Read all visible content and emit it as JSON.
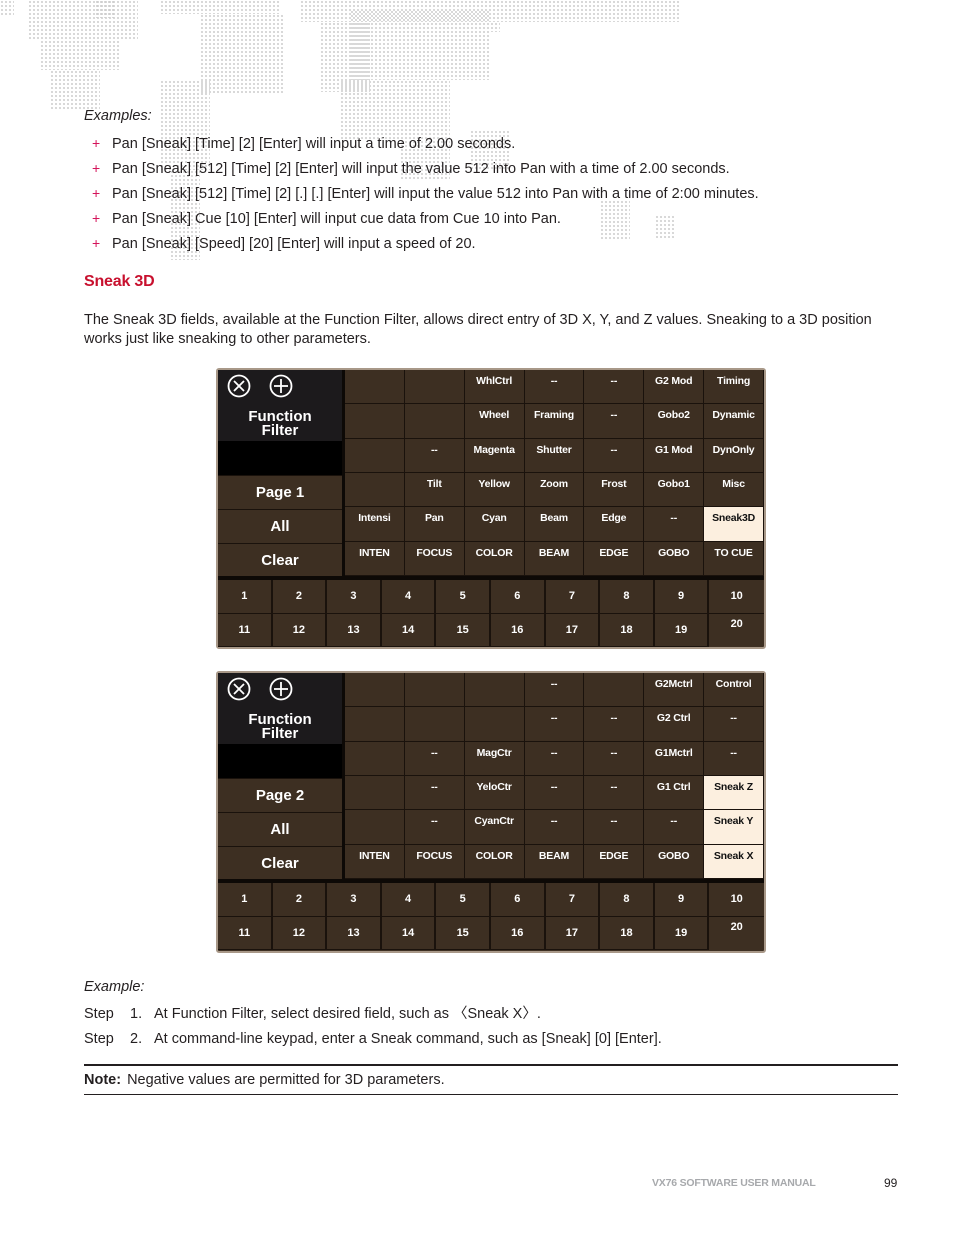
{
  "examples": {
    "label": "Examples:",
    "bullet_symbol": "+",
    "items": [
      "Pan [Sneak] [Time] [2] [Enter] will input a time of 2.00 seconds.",
      "Pan [Sneak] [512] [Time] [2] [Enter] will input the value 512 into Pan with a time of 2.00 seconds.",
      "Pan [Sneak] [512] [Time] [2] [.] [.] [Enter] will input the value 512 into Pan with a time of 2:00 minutes.",
      "Pan [Sneak] Cue [10] [Enter] will input cue data from Cue 10 into Pan.",
      "Pan [Sneak] [Speed] [20] [Enter] will input a speed of 20."
    ]
  },
  "section": {
    "title": "Sneak 3D",
    "intro": "The Sneak 3D fields, available at the Function Filter, allows direct entry of 3D X, Y, and Z values. Sneaking to a 3D position works just like sneaking to other parameters."
  },
  "panels": [
    {
      "title_line1": "Function",
      "title_line2": "Filter",
      "page_label": "Page 1",
      "all_label": "All",
      "clear_label": "Clear",
      "icons": [
        "close-circle-icon",
        "add-circle-icon"
      ],
      "grid": [
        [
          "",
          "",
          "WhlCtrl",
          "--",
          "--",
          "G2 Mod",
          "Timing"
        ],
        [
          "",
          "",
          "Wheel",
          "Framing",
          "--",
          "Gobo2",
          "Dynamic"
        ],
        [
          "",
          "--",
          "Magenta",
          "Shutter",
          "--",
          "G1 Mod",
          "DynOnly"
        ],
        [
          "",
          "Tilt",
          "Yellow",
          "Zoom",
          "Frost",
          "Gobo1",
          "Misc"
        ],
        [
          "Intensi",
          "Pan",
          "Cyan",
          "Beam",
          "Edge",
          "--",
          "Sneak3D"
        ],
        [
          "INTEN",
          "FOCUS",
          "COLOR",
          "BEAM",
          "EDGE",
          "GOBO",
          "TO CUE"
        ]
      ],
      "highlighted": [
        "4-6"
      ],
      "numbers_row1": [
        "1",
        "2",
        "3",
        "4",
        "5",
        "6",
        "7",
        "8",
        "9",
        "10"
      ],
      "numbers_row2": [
        "11",
        "12",
        "13",
        "14",
        "15",
        "16",
        "17",
        "18",
        "19",
        "20"
      ]
    },
    {
      "title_line1": "Function",
      "title_line2": "Filter",
      "page_label": "Page 2",
      "all_label": "All",
      "clear_label": "Clear",
      "icons": [
        "close-circle-icon",
        "add-circle-icon"
      ],
      "grid": [
        [
          "",
          "",
          "",
          "--",
          "",
          "G2Mctrl",
          "Control"
        ],
        [
          "",
          "",
          "",
          "--",
          "--",
          "G2 Ctrl",
          "--"
        ],
        [
          "",
          "--",
          "MagCtr",
          "--",
          "--",
          "G1Mctrl",
          "--"
        ],
        [
          "",
          "--",
          "YeloCtr",
          "--",
          "--",
          "G1 Ctrl",
          "Sneak Z"
        ],
        [
          "",
          "--",
          "CyanCtr",
          "--",
          "--",
          "--",
          "Sneak Y"
        ],
        [
          "INTEN",
          "FOCUS",
          "COLOR",
          "BEAM",
          "EDGE",
          "GOBO",
          "Sneak X"
        ]
      ],
      "highlighted": [
        "3-6",
        "4-6",
        "5-6"
      ],
      "numbers_row1": [
        "1",
        "2",
        "3",
        "4",
        "5",
        "6",
        "7",
        "8",
        "9",
        "10"
      ],
      "numbers_row2": [
        "11",
        "12",
        "13",
        "14",
        "15",
        "16",
        "17",
        "18",
        "19",
        "20"
      ]
    }
  ],
  "example": {
    "label": "Example:",
    "steps": [
      {
        "word": "Step",
        "num": "1.",
        "text": "At Function Filter, select desired field, such as 〈Sneak X〉."
      },
      {
        "word": "Step",
        "num": "2.",
        "text": "At command-line keypad, enter a Sneak command, such as [Sneak] [0] [Enter]."
      }
    ]
  },
  "note": {
    "label": "Note:",
    "text": "Negative values are permitted for 3D parameters."
  },
  "footer": {
    "manual_title": "VX76 SOFTWARE USER MANUAL",
    "page_number": "99"
  },
  "colors": {
    "accent_red": "#c8102e",
    "bullet_pink": "#d4145a",
    "panel_brown": "#3d2f22",
    "highlight_cell": "#fcefdf",
    "footer_gray": "#a7a9ac"
  }
}
